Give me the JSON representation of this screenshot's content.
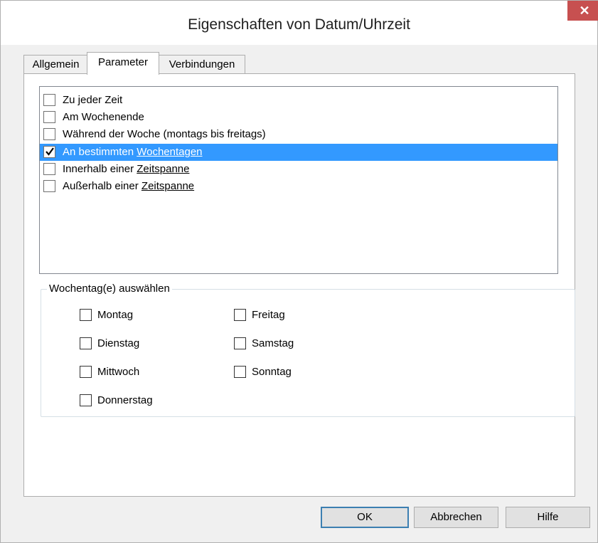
{
  "window": {
    "title": "Eigenschaften von Datum/Uhrzeit",
    "close_label": "✕"
  },
  "tabs": [
    {
      "label": "Allgemein",
      "active": false
    },
    {
      "label": "Parameter",
      "active": true
    },
    {
      "label": "Verbindungen",
      "active": false
    }
  ],
  "conditions": [
    {
      "text": "Zu jeder Zeit",
      "link": "",
      "checked": false
    },
    {
      "text": "Am Wochenende",
      "link": "",
      "checked": false
    },
    {
      "text": "Während der Woche (montags bis freitags)",
      "link": "",
      "checked": false
    },
    {
      "text": "An bestimmten ",
      "link": "Wochentagen",
      "checked": true,
      "selected": true
    },
    {
      "text": "Innerhalb einer ",
      "link": "Zeitspanne",
      "checked": false
    },
    {
      "text": "Außerhalb einer ",
      "link": "Zeitspanne",
      "checked": false
    }
  ],
  "weekday_group": {
    "legend": "Wochentag(e) auswählen",
    "days": [
      {
        "label": "Montag",
        "checked": false
      },
      {
        "label": "Dienstag",
        "checked": false
      },
      {
        "label": "Mittwoch",
        "checked": false
      },
      {
        "label": "Donnerstag",
        "checked": false
      },
      {
        "label": "Freitag",
        "checked": false
      },
      {
        "label": "Samstag",
        "checked": false
      },
      {
        "label": "Sonntag",
        "checked": false
      }
    ]
  },
  "buttons": {
    "ok": "OK",
    "cancel": "Abbrechen",
    "help": "Hilfe"
  },
  "colors": {
    "selection": "#3399ff",
    "close_button": "#c75050",
    "default_button_border": "#3c7fb1"
  }
}
